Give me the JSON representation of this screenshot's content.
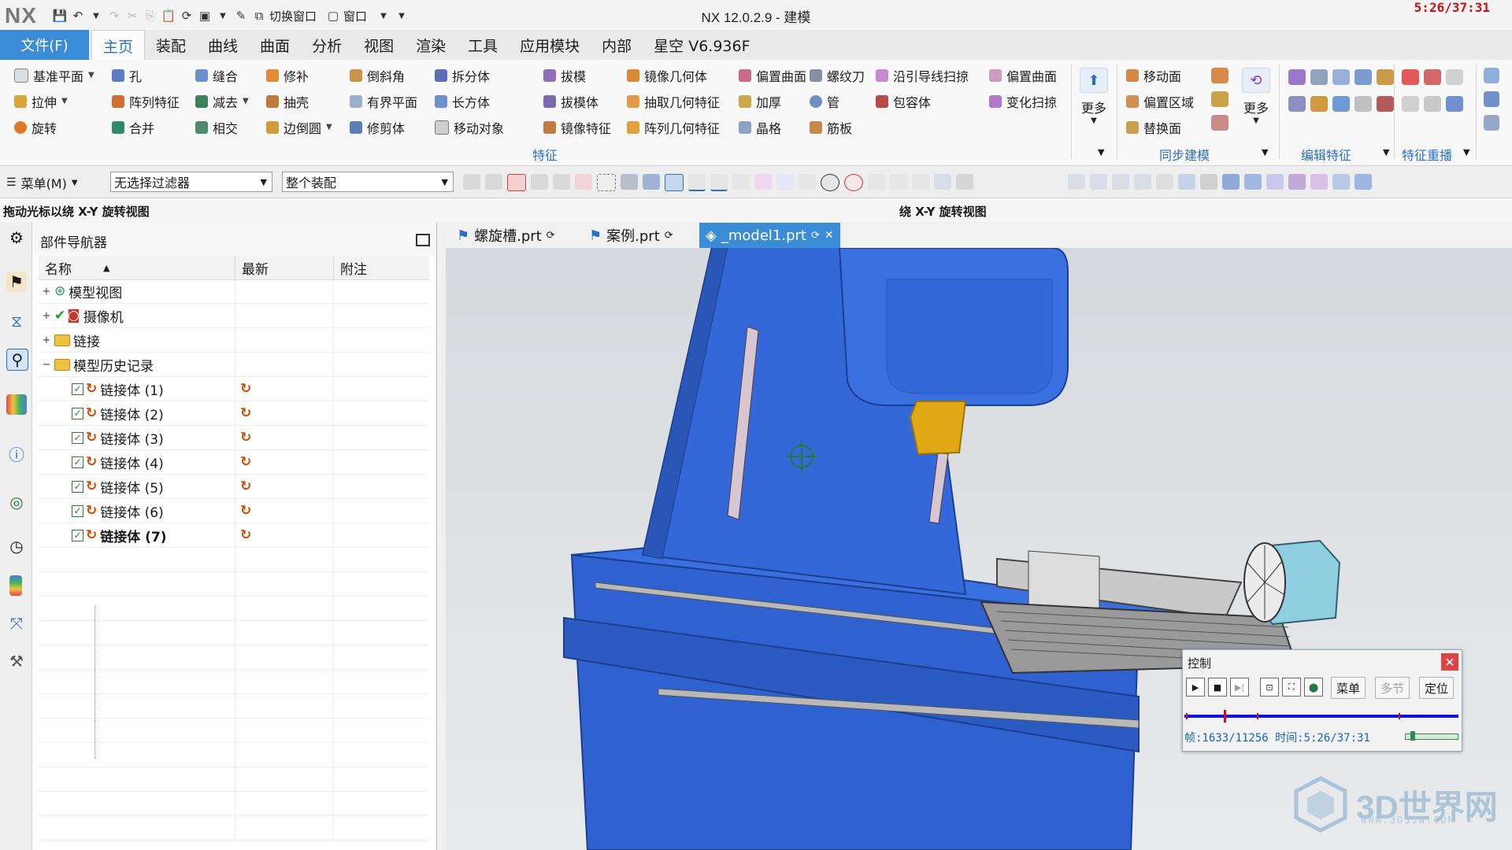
{
  "title_bar": {
    "logo": "NX",
    "switch_window_label": "切换窗口",
    "window_label": "窗口",
    "app_title": "NX 12.0.2.9 - 建模",
    "clock": "5:26/37:31"
  },
  "menu": {
    "file_tab": "文件(F)",
    "tabs": [
      "主页",
      "装配",
      "曲线",
      "曲面",
      "分析",
      "视图",
      "渲染",
      "工具",
      "应用模块",
      "内部",
      "星空 V6.936F"
    ]
  },
  "ribbon": {
    "col1": [
      "基准平面",
      "拉伸",
      "旋转"
    ],
    "col2": [
      "孔",
      "阵列特征",
      "合并"
    ],
    "col3": [
      "缝合",
      "减去",
      "相交"
    ],
    "col4": [
      "修补",
      "抽壳",
      "边倒圆"
    ],
    "col5": [
      "倒斜角",
      "有界平面",
      "修剪体"
    ],
    "col6": [
      "拆分体",
      "长方体",
      "移动对象"
    ],
    "col7": [
      "拔模",
      "拔模体",
      "镜像特征"
    ],
    "col8": [
      "镜像几何体",
      "抽取几何特征",
      "阵列几何特征"
    ],
    "col9": [
      "偏置曲面",
      "加厚",
      "晶格"
    ],
    "col10": [
      "螺纹刀",
      "管",
      "筋板"
    ],
    "col11": [
      "沿引导线扫掠",
      "包容体"
    ],
    "col12": [
      "偏置曲面",
      "变化扫掠"
    ],
    "more1": "更多",
    "col13": [
      "移动面",
      "偏置区域",
      "替换面"
    ],
    "more2": "更多",
    "group_features": "特征",
    "group_sync": "同步建模",
    "group_edit": "编辑特征",
    "group_replay": "特征重播"
  },
  "selection_bar": {
    "menu_label": "菜单(M)",
    "filter": "无选择过滤器",
    "scope": "整个装配"
  },
  "hint": {
    "left": "拖动光标以绕 X-Y 旋转视图",
    "center": "绕 X-Y 旋转视图"
  },
  "navigator": {
    "title": "部件导航器",
    "columns": [
      "名称",
      "最新",
      "附注"
    ],
    "rows": [
      {
        "label": "模型视图",
        "type": "view"
      },
      {
        "label": "摄像机",
        "type": "camera"
      },
      {
        "label": "链接",
        "type": "folder"
      },
      {
        "label": "模型历史记录",
        "type": "folder"
      },
      {
        "label": "链接体 (1)",
        "type": "feature"
      },
      {
        "label": "链接体 (2)",
        "type": "feature"
      },
      {
        "label": "链接体 (3)",
        "type": "feature"
      },
      {
        "label": "链接体 (4)",
        "type": "feature"
      },
      {
        "label": "链接体 (5)",
        "type": "feature"
      },
      {
        "label": "链接体 (6)",
        "type": "feature"
      },
      {
        "label": "链接体 (7)",
        "type": "feature"
      }
    ]
  },
  "graphics_tabs": [
    "螺旋槽.prt",
    "案例.prt",
    "_model1.prt"
  ],
  "control_dialog": {
    "title": "控制",
    "menu_btn": "菜单",
    "step_btn": "多节",
    "locate_btn": "定位",
    "status": "帧:1633/11256 时间:5:26/37:31",
    "progress": 0.145
  },
  "watermark": {
    "text": "3D世界网",
    "sub": "WWW.3DSJW.COM"
  },
  "colors": {
    "accent": "#3a8cd6",
    "model": "#3268d6",
    "clock": "#cc1010"
  }
}
